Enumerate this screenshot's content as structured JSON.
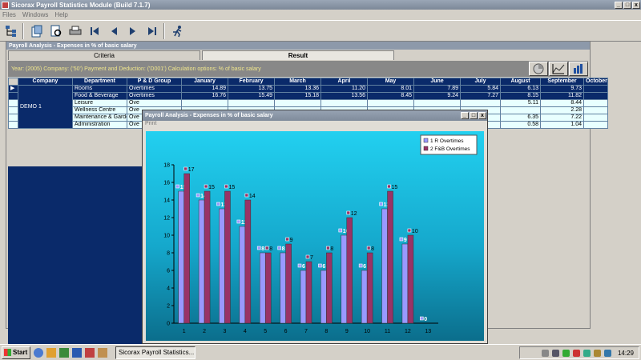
{
  "app": {
    "title": "Sicorax Payroll Statistics Module (Build 7.1.7)"
  },
  "menu": [
    "Files",
    "Windows",
    "Help"
  ],
  "analysis": {
    "title": "Payroll Analysis - Expenses in % of basic salary",
    "tabs": [
      "Criteria",
      "Result"
    ],
    "info": "Year: (2005) Company: ('50') Payment and Deduction: ('D001') Calculation options: % of basic salary"
  },
  "grid": {
    "headers": [
      "Company",
      "Department",
      "P & D Group",
      "January",
      "February",
      "March",
      "April",
      "May",
      "June",
      "July",
      "August",
      "September",
      "October"
    ],
    "company": "DEMO 1",
    "rows": [
      {
        "dept": "Rooms",
        "group": "Overtimes",
        "vals": [
          "14.89",
          "13.75",
          "13.36",
          "11.20",
          "8.01",
          "7.89",
          "5.84",
          "6.13",
          "9.73",
          ""
        ]
      },
      {
        "dept": "Food & Beverage",
        "group": "Overtimes",
        "vals": [
          "16.76",
          "15.49",
          "15.18",
          "13.56",
          "8.45",
          "9.24",
          "7.27",
          "8.15",
          "11.82",
          ""
        ]
      },
      {
        "dept": "Leisure",
        "group": "Ove",
        "vals": [
          "",
          "",
          "",
          "",
          "",
          "",
          "",
          "5.11",
          "8.44",
          ""
        ]
      },
      {
        "dept": "Wellness Centre",
        "group": "Ove",
        "vals": [
          "",
          "",
          "",
          "",
          "",
          "",
          "",
          "",
          "2.28",
          ""
        ]
      },
      {
        "dept": "Maintenance & Garde",
        "group": "Ove",
        "vals": [
          "",
          "",
          "",
          "",
          "",
          "",
          "",
          "6.35",
          "7.22",
          ""
        ]
      },
      {
        "dept": "Administration",
        "group": "Ove",
        "vals": [
          "",
          "",
          "",
          "",
          "",
          "",
          "",
          "0.58",
          "1.04",
          ""
        ]
      }
    ]
  },
  "chart_window": {
    "title": "Payroll Analysis - Expenses in % of basic salary",
    "menu": "Print"
  },
  "chart_data": {
    "type": "bar",
    "categories": [
      "1",
      "2",
      "3",
      "4",
      "5",
      "6",
      "7",
      "8",
      "9",
      "10",
      "11",
      "12",
      "13"
    ],
    "series": [
      {
        "name": "1 R Overtimes",
        "color": "#9999ff",
        "values": [
          15,
          14,
          13,
          11,
          8,
          8,
          6,
          6,
          10,
          6,
          13,
          9,
          0
        ],
        "labels": [
          "15",
          "14",
          "13",
          "11",
          "8",
          "8",
          "6",
          "6",
          "10",
          "6",
          "13",
          "9",
          "0"
        ]
      },
      {
        "name": "2 F&B Overtimes",
        "color": "#993366",
        "values": [
          17,
          15,
          15,
          14,
          8,
          9,
          7,
          8,
          12,
          8,
          15,
          10,
          null
        ],
        "labels": [
          "17",
          "15",
          "15",
          "14",
          "8",
          "9",
          "7",
          "8",
          "12",
          "8",
          "15",
          "10",
          ""
        ]
      }
    ],
    "ylim": [
      0,
      18
    ],
    "yticks": [
      "0",
      "2",
      "4",
      "6",
      "8",
      "10",
      "12",
      "14",
      "16",
      "18"
    ],
    "legend": "top-right",
    "grid": false
  },
  "taskbar": {
    "start": "Start",
    "task": "Sicorax Payroll Statistics...",
    "clock": "14:29"
  }
}
